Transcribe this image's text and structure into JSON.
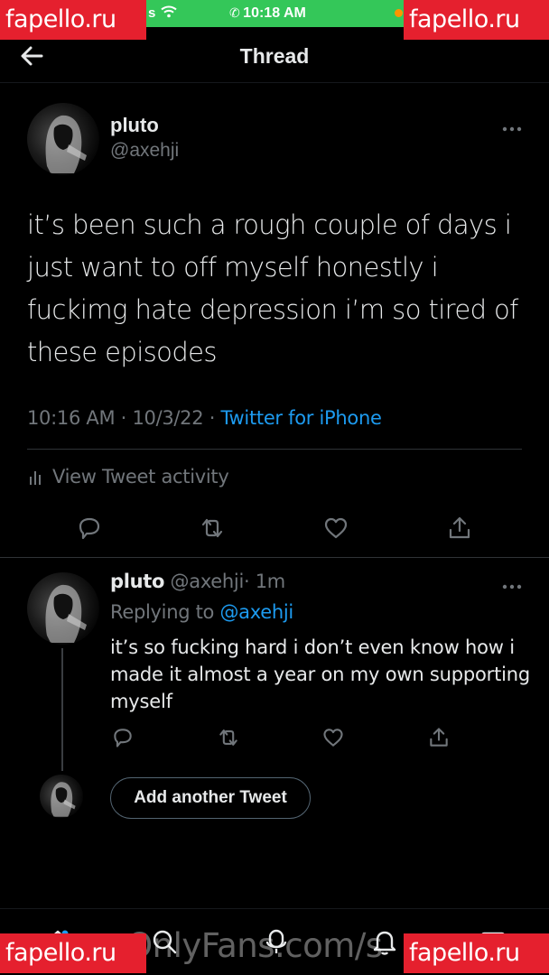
{
  "status_bar": {
    "time": "10:18 AM",
    "carrier_fragment": "s",
    "pill_color": "#34c759"
  },
  "watermarks": {
    "top_left": "fapello.ru",
    "top_right": "fapello.ru",
    "bottom_left": "fapello.ru",
    "bottom_right": "fapello.ru",
    "bottom_center": "OnlyFans.com/s",
    "color": "#e5202e"
  },
  "header": {
    "title": "Thread",
    "back_icon": "arrow-left-icon"
  },
  "main_tweet": {
    "name": "pluto",
    "handle": "@axehji",
    "text": "it’s been such a rough couple of days i just want to off myself honestly i fuckimg hate depression i’m so tired of these episodes",
    "time": "10:16 AM",
    "separator": "·",
    "date": "10/3/22",
    "source": "Twitter for iPhone",
    "activity_label": "View Tweet activity",
    "actions": [
      "reply-icon",
      "retweet-icon",
      "like-icon",
      "share-icon"
    ]
  },
  "reply_tweet": {
    "name": "pluto",
    "handle": "@axehji",
    "age": "· 1m",
    "replying_prefix": "Replying to",
    "replying_to": "@axehji",
    "text": "it’s so fucking hard i don’t even know how i made it almost a year on my own supporting myself",
    "actions": [
      "reply-icon",
      "retweet-icon",
      "like-icon",
      "share-icon"
    ]
  },
  "compose": {
    "add_label": "Add another Tweet"
  },
  "tab_bar": {
    "tabs": [
      "home-icon",
      "search-icon",
      "spaces-icon",
      "notifications-icon",
      "messages-icon"
    ]
  },
  "colors": {
    "background": "#000000",
    "text_primary": "#e7e9ea",
    "text_secondary": "#71767b",
    "accent": "#1d9bf0"
  }
}
